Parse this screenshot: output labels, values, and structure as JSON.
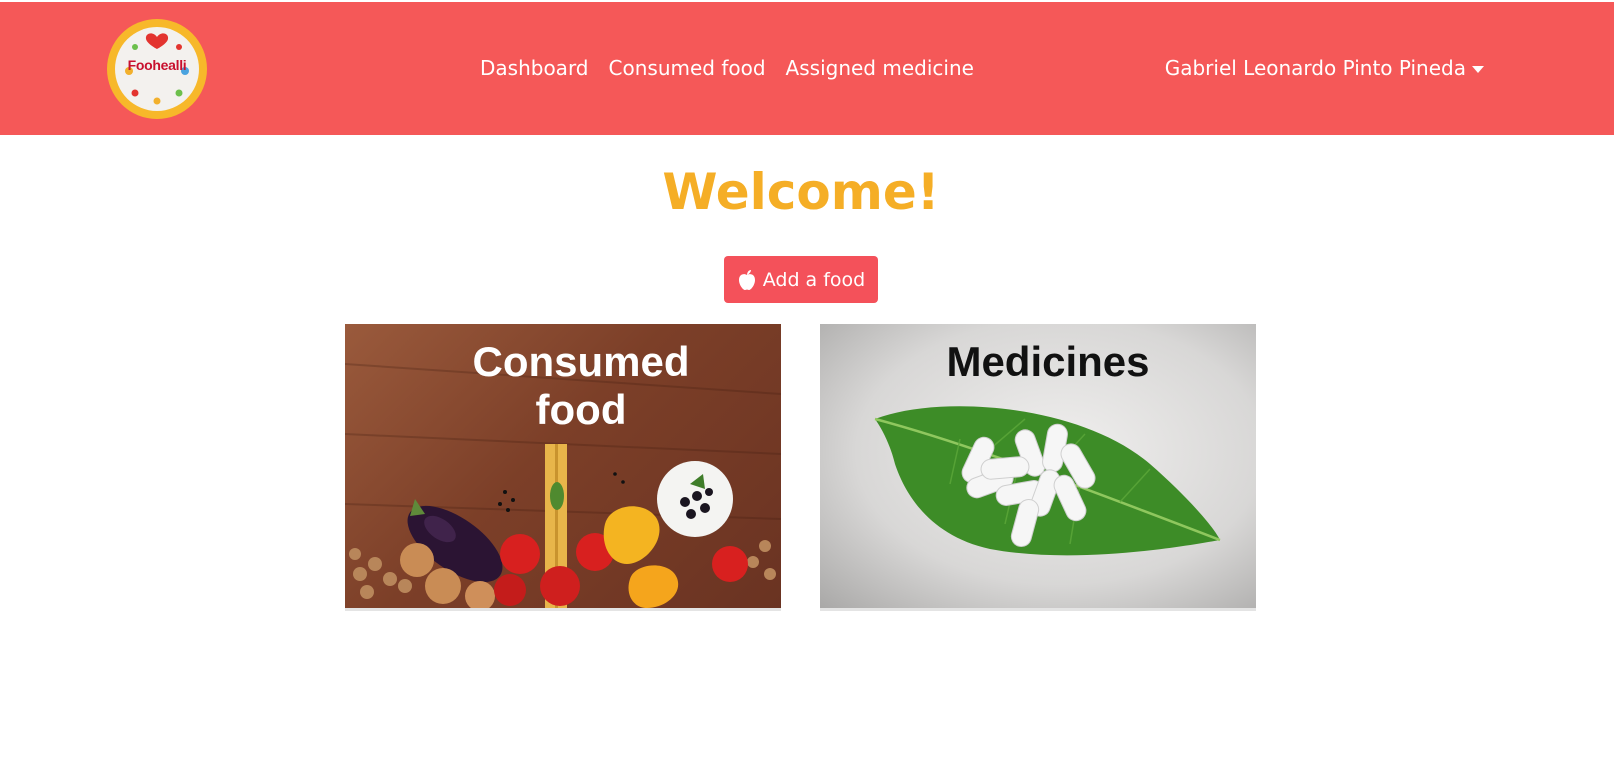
{
  "app": {
    "logo_text": "Foohealli"
  },
  "nav": {
    "items": [
      {
        "label": "Dashboard"
      },
      {
        "label": "Consumed food"
      },
      {
        "label": "Assigned medicine"
      }
    ],
    "user_name": "Gabriel Leonardo Pinto Pineda"
  },
  "main": {
    "heading": "Welcome!",
    "add_button": {
      "label": "Add a food",
      "icon": "apple-icon"
    },
    "cards": [
      {
        "title_line1": "Consumed",
        "title_line2": "food"
      },
      {
        "title": "Medicines"
      }
    ]
  },
  "colors": {
    "navbar": "#f55858",
    "heading": "#f5ae26",
    "button": "#f4515a"
  }
}
